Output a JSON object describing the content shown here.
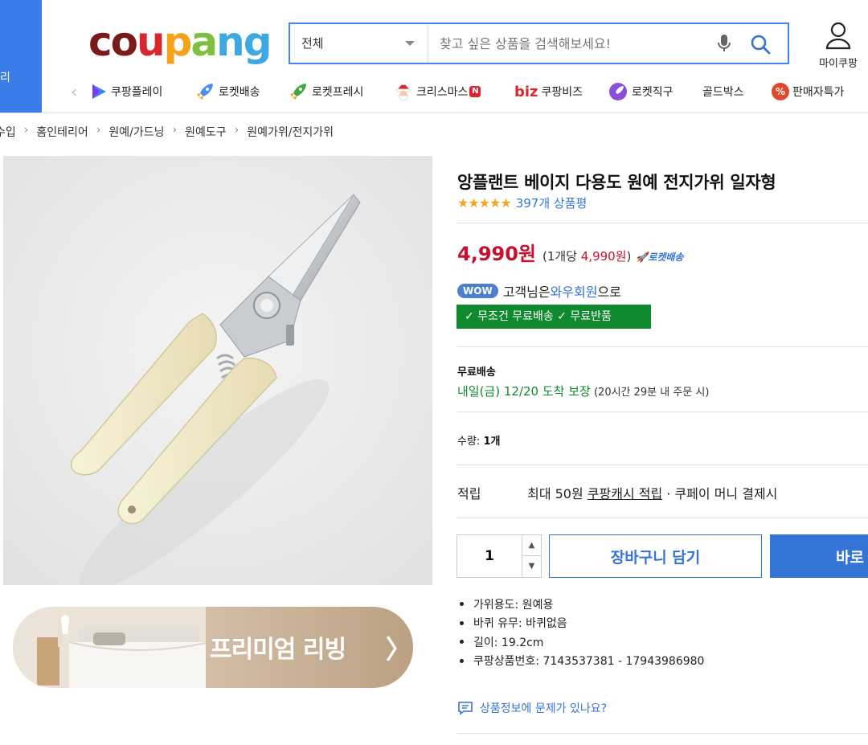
{
  "header": {
    "category_label": "리",
    "logo_letters": [
      {
        "ch": "c",
        "color": "#7a1a1a"
      },
      {
        "ch": "o",
        "color": "#7a1a1a"
      },
      {
        "ch": "u",
        "color": "#d8282e"
      },
      {
        "ch": "p",
        "color": "#f4a11b"
      },
      {
        "ch": "a",
        "color": "#7fbf3f"
      },
      {
        "ch": "n",
        "color": "#3ea9e0"
      },
      {
        "ch": "g",
        "color": "#3ea9e0"
      }
    ],
    "search": {
      "category_value": "전체",
      "placeholder": "찾고 싶은 상품을 검색해보세요!"
    },
    "my_coupang_label": "마이쿠팡",
    "quick_nav": [
      {
        "label": "쿠팡플레이",
        "icon": "play-icon"
      },
      {
        "label": "로켓배송",
        "icon": "rocket-icon"
      },
      {
        "label": "로켓프레시",
        "icon": "rocket-fresh-icon"
      },
      {
        "label": "크리스마스",
        "icon": "santa-icon",
        "badge": "N"
      },
      {
        "label": "쿠팡비즈",
        "icon": "biz-icon",
        "prefix": "biz"
      },
      {
        "label": "로켓직구",
        "icon": "global-rocket-icon"
      },
      {
        "label": "골드박스",
        "icon": ""
      },
      {
        "label": "판매자특가",
        "icon": "percent-icon",
        "icon_text": "%"
      }
    ]
  },
  "breadcrumb": [
    "수입",
    "홈인테리어",
    "원예/가드닝",
    "원예도구",
    "원예가위/전지가위"
  ],
  "product": {
    "title": "앙플랜트 베이지 다용도 원예 전지가위 일자형",
    "stars": "★★★★★",
    "rating": 4.5,
    "review_count": "397개 상품평",
    "price": "4,990원",
    "unit_price_open": "(1개당 ",
    "unit_price_value": "4,990원",
    "unit_price_close": ")",
    "rocket_label": "🚀로켓배송",
    "wow_badge": "WOW",
    "wow_prefix": "고객님은 ",
    "wow_link": "와우회원",
    "wow_suffix": "으로",
    "free_badge": "✓ 무조건 무료배송 ✓ 무료반품",
    "shipping_title": "무료배송",
    "shipping_date_green": "내일(금) 12/20 도착 보장",
    "shipping_date_note": " (20시간 29분 내 주문 시)",
    "quantity_label": "수량: ",
    "quantity_text": "1개",
    "points_label": "적립",
    "points_prefix": "최대 50원 ",
    "points_link": "쿠팡캐시 적립",
    "points_suffix": " · 쿠페이 머니 결제시",
    "stepper_value": "1",
    "cart_button": "장바구니 담기",
    "buy_button": "바로",
    "specs": [
      "가위용도: 원예용",
      "바퀴 유무: 바퀴없음",
      "길이: 19.2cm",
      "쿠팡상품번호: 7143537381 - 17943986980"
    ],
    "report_link": "상품정보에 문제가 있나요?"
  },
  "banner": {
    "label": "프리미엄 리빙",
    "chevron": "〉"
  },
  "colors": {
    "accent": "#3474d6",
    "price": "#c8102e",
    "free_badge": "#0f8a2e",
    "category_strip": "#3a7de8"
  }
}
